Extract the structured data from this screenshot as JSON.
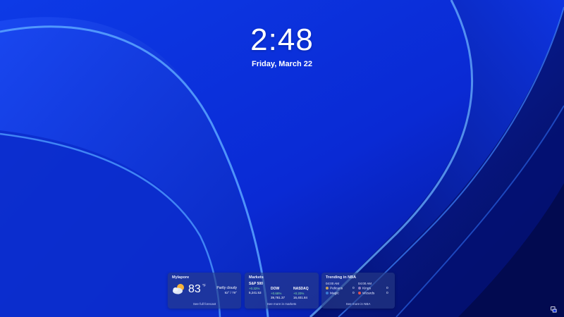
{
  "lockscreen": {
    "time": "2:48",
    "date": "Friday, March 22"
  },
  "weather": {
    "location": "Mylapore",
    "temperature": "83",
    "unit": "°F",
    "condition": "Partly cloudy",
    "range": "92° / 79°",
    "icon": "partly-cloudy-icon",
    "link": "See full forecast"
  },
  "markets": {
    "title": "Markets",
    "indices": [
      {
        "name": "S&P 500",
        "change": "+0.32%",
        "value": "5,241.53"
      },
      {
        "name": "DOW",
        "change": "+0.68%",
        "value": "39,781.37"
      },
      {
        "name": "NASDAQ",
        "change": "+0.20%",
        "value": "16,401.84"
      }
    ],
    "change_color": "#7ee0a6",
    "link": "See more in markets"
  },
  "nba": {
    "title": "Trending in NBA",
    "games": [
      {
        "time": "04:00 AM",
        "teams": [
          {
            "name": "Pelicans",
            "score": "0"
          },
          {
            "name": "Magic",
            "score": "0"
          }
        ]
      },
      {
        "time": "04:00 AM",
        "teams": [
          {
            "name": "Kings",
            "score": "0"
          },
          {
            "name": "Wizards",
            "score": "0"
          }
        ]
      }
    ],
    "link": "See more in NBA"
  },
  "colors": {
    "wallpaper_base": "#0a2bd6",
    "wallpaper_highlight": "#5aa6ff"
  }
}
